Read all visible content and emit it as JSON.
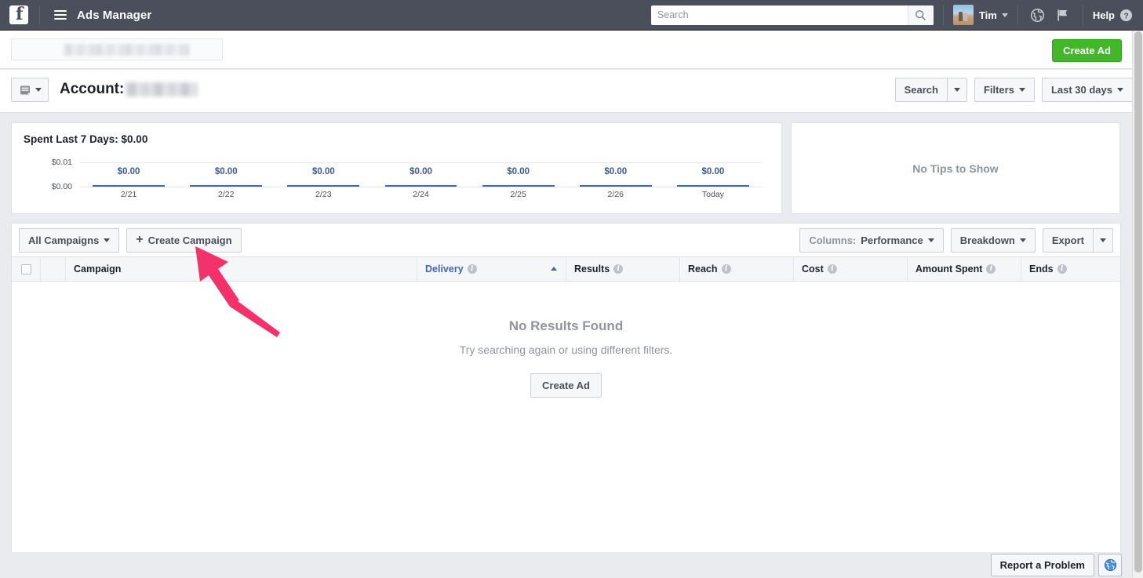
{
  "topbar": {
    "logo_icon": "facebook-logo-icon",
    "menu_icon": "hamburger-menu-icon",
    "app_title": "Ads Manager",
    "search": {
      "placeholder": "Search",
      "value": "",
      "icon": "search-icon"
    },
    "user": {
      "name": "Tim",
      "avatar_icon": "user-avatar",
      "caret_icon": "chevron-down-icon"
    },
    "globe_icon": "globe-icon",
    "flag_icon": "flag-icon",
    "help_label": "Help",
    "help_icon": "question-mark-circle-icon"
  },
  "account_strip": {
    "account_picker_value": "",
    "create_ad_label": "Create Ad"
  },
  "titlebar": {
    "account_icon": "account-card-icon",
    "account_label": "Account:",
    "account_value": "",
    "search_label": "Search",
    "filters_label": "Filters",
    "date_range_label": "Last 30 days"
  },
  "spend_panel": {
    "title": "Spent Last 7 Days: $0.00"
  },
  "tips_panel": {
    "message": "No Tips to Show"
  },
  "toolbar": {
    "all_campaigns_label": "All Campaigns",
    "create_campaign_label": "Create Campaign",
    "create_campaign_icon": "plus-icon",
    "columns_prefix": "Columns:",
    "columns_value": "Performance",
    "breakdown_label": "Breakdown",
    "export_label": "Export"
  },
  "table": {
    "columns": [
      {
        "label": "Campaign",
        "info": false,
        "sorted": false
      },
      {
        "label": "Delivery",
        "info": true,
        "sorted": true
      },
      {
        "label": "Results",
        "info": true,
        "sorted": false
      },
      {
        "label": "Reach",
        "info": true,
        "sorted": false
      },
      {
        "label": "Cost",
        "info": true,
        "sorted": false
      },
      {
        "label": "Amount Spent",
        "info": true,
        "sorted": false
      },
      {
        "label": "Ends",
        "info": true,
        "sorted": false
      }
    ],
    "rows": [],
    "empty_state": {
      "heading": "No Results Found",
      "subtext": "Try searching again or using different filters.",
      "button_label": "Create Ad"
    }
  },
  "footer": {
    "report_label": "Report a Problem",
    "globe_icon": "globe-icon"
  },
  "annotation": {
    "arrow_color": "#f4316a",
    "points_at": "create-campaign-button"
  },
  "colors": {
    "nav_background": "#4b4f5c",
    "page_background": "#e9ebee",
    "accent_green": "#42b72a",
    "link_blue": "#4267b2",
    "chart_bar": "#4267b2",
    "muted_text": "#90949c"
  },
  "chart_data": {
    "type": "bar",
    "title": "Spent Last 7 Days: $0.00",
    "categories": [
      "2/21",
      "2/22",
      "2/23",
      "2/24",
      "2/25",
      "2/26",
      "Today"
    ],
    "values": [
      0.0,
      0.0,
      0.0,
      0.0,
      0.0,
      0.0,
      0.0
    ],
    "data_labels": [
      "$0.00",
      "$0.00",
      "$0.00",
      "$0.00",
      "$0.00",
      "$0.00",
      "$0.00"
    ],
    "ytick_labels": [
      "$0.01",
      "$0.00"
    ],
    "ylim": [
      0,
      0.01
    ],
    "xlabel": "",
    "ylabel": "",
    "grid": true,
    "legend": false
  }
}
